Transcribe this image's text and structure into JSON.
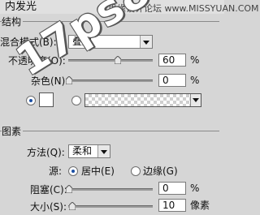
{
  "panel": {
    "title": "内发光",
    "banner": "思缘设计论坛  www.MISSYUAN.COM"
  },
  "structure": {
    "section_title": "结构",
    "blend_mode": {
      "label": "混合模式(B):",
      "value": "叠加"
    },
    "opacity": {
      "label": "不透明度(O):",
      "value": "60",
      "unit": "%",
      "level": 0.6
    },
    "noise": {
      "label": "杂色(N):",
      "value": "0",
      "unit": "%",
      "level": 0
    },
    "color_swatch": "#ffffff"
  },
  "elements": {
    "section_title": "图素",
    "technique": {
      "label": "方法(Q):",
      "value": "柔和"
    },
    "source": {
      "label": "源:",
      "center_label": "居中(E)",
      "edge_label": "边缘(G)",
      "selected": "center"
    },
    "choke": {
      "label": "阻塞(C):",
      "value": "0",
      "unit": "%",
      "level": 0
    },
    "size": {
      "label": "大小(S):",
      "value": "10",
      "unit": "像素",
      "level": 0.04
    }
  },
  "watermark": "17ps8.com",
  "colors": {
    "panel_bg": "#d6d6d6",
    "radio_selected": "#1a4fa5"
  }
}
